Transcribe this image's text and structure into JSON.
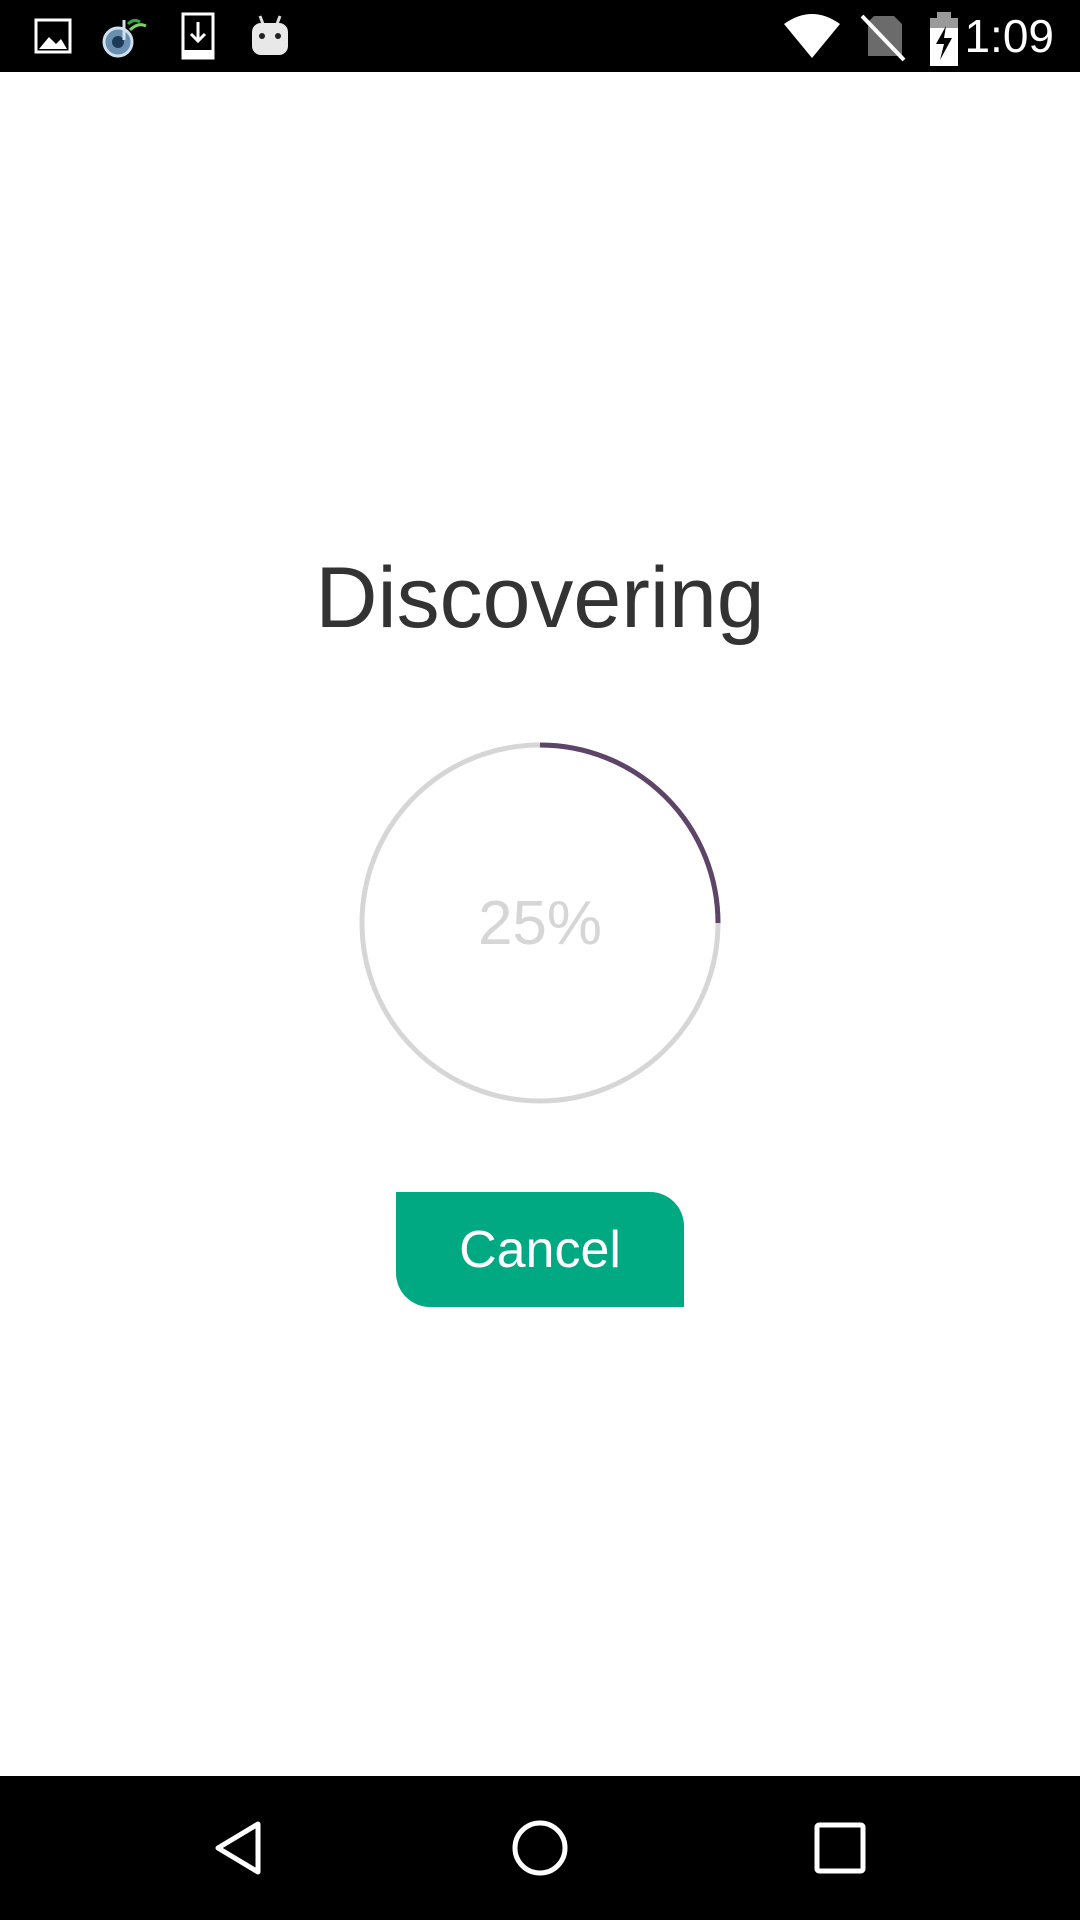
{
  "status_bar": {
    "time": "1:09",
    "notification_icons": [
      "image-icon",
      "music-app-icon",
      "download-icon",
      "android-icon"
    ],
    "system_icons": [
      "wifi-icon",
      "no-sim-icon",
      "battery-charging-icon"
    ]
  },
  "main": {
    "title": "Discovering",
    "progress": {
      "value": 0.25,
      "label": "25%",
      "track_color": "#d6d6d6",
      "fill_color": "#5e4468"
    },
    "cancel_label": "Cancel",
    "accent_color": "#00a981"
  },
  "nav_bar": {
    "buttons": [
      "back-icon",
      "home-icon",
      "recents-icon"
    ]
  }
}
